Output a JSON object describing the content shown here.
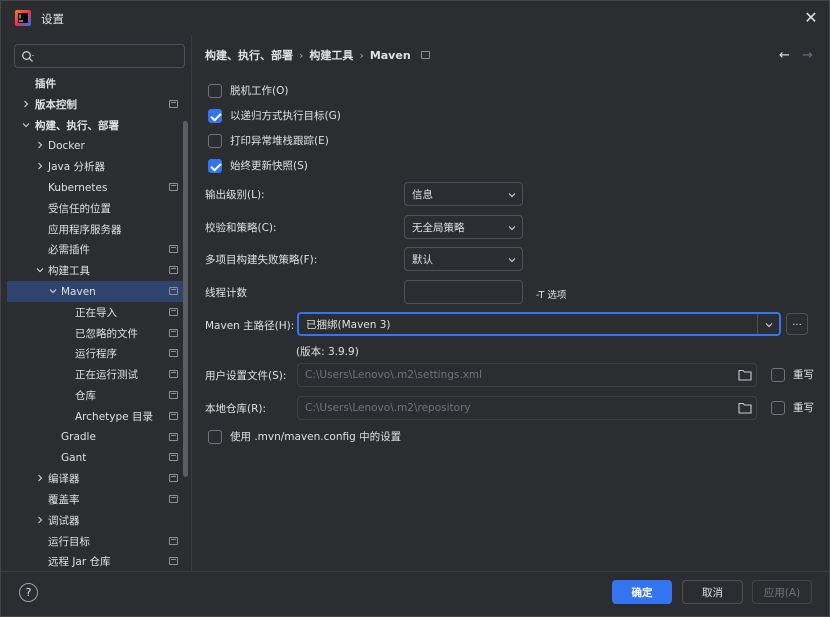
{
  "window": {
    "title": "设置"
  },
  "search": {
    "placeholder": ""
  },
  "tree": [
    {
      "label": "插件",
      "level": 0,
      "chev": "",
      "pg": false,
      "bold": true
    },
    {
      "label": "版本控制",
      "level": 0,
      "chev": "right",
      "pg": true,
      "bold": true
    },
    {
      "label": "构建、执行、部署",
      "level": 0,
      "chev": "down",
      "pg": false,
      "bold": true
    },
    {
      "label": "Docker",
      "level": 1,
      "chev": "right",
      "pg": false
    },
    {
      "label": "Java 分析器",
      "level": 1,
      "chev": "right",
      "pg": false
    },
    {
      "label": "Kubernetes",
      "level": 1,
      "chev": "",
      "pg": true
    },
    {
      "label": "受信任的位置",
      "level": 1,
      "chev": "",
      "pg": false
    },
    {
      "label": "应用程序服务器",
      "level": 1,
      "chev": "",
      "pg": false
    },
    {
      "label": "必需插件",
      "level": 1,
      "chev": "",
      "pg": true
    },
    {
      "label": "构建工具",
      "level": 1,
      "chev": "down",
      "pg": true
    },
    {
      "label": "Maven",
      "level": 2,
      "chev": "down",
      "pg": true,
      "selected": true
    },
    {
      "label": "正在导入",
      "level": 3,
      "chev": "",
      "pg": true
    },
    {
      "label": "已忽略的文件",
      "level": 3,
      "chev": "",
      "pg": true
    },
    {
      "label": "运行程序",
      "level": 3,
      "chev": "",
      "pg": true
    },
    {
      "label": "正在运行测试",
      "level": 3,
      "chev": "",
      "pg": true
    },
    {
      "label": "仓库",
      "level": 3,
      "chev": "",
      "pg": true
    },
    {
      "label": "Archetype 目录",
      "level": 3,
      "chev": "",
      "pg": true
    },
    {
      "label": "Gradle",
      "level": 2,
      "chev": "",
      "pg": true
    },
    {
      "label": "Gant",
      "level": 2,
      "chev": "",
      "pg": true
    },
    {
      "label": "编译器",
      "level": 1,
      "chev": "right",
      "pg": true
    },
    {
      "label": "覆盖率",
      "level": 1,
      "chev": "",
      "pg": true
    },
    {
      "label": "调试器",
      "level": 1,
      "chev": "right",
      "pg": false
    },
    {
      "label": "运行目标",
      "level": 1,
      "chev": "",
      "pg": true
    },
    {
      "label": "远程 Jar 仓库",
      "level": 1,
      "chev": "",
      "pg": true
    }
  ],
  "breadcrumb": {
    "part1": "构建、执行、部署",
    "part2": "构建工具",
    "part3": "Maven"
  },
  "options": {
    "offline": {
      "label": "脱机工作(O)",
      "checked": false
    },
    "recursive": {
      "label": "以递归方式执行目标(G)",
      "checked": true
    },
    "stacktrace": {
      "label": "打印异常堆栈跟踪(E)",
      "checked": false
    },
    "update_snapshots": {
      "label": "始终更新快照(S)",
      "checked": true
    }
  },
  "output_level": {
    "label": "输出级别(L):",
    "value": "信息"
  },
  "checksum_policy": {
    "label": "校验和策略(C):",
    "value": "无全局策略"
  },
  "failure_policy": {
    "label": "多项目构建失败策略(F):",
    "value": "默认"
  },
  "thread_count": {
    "label": "线程计数",
    "value": "",
    "hint": "-T 选项"
  },
  "maven_home": {
    "label": "Maven 主路径(H):",
    "value": "已捆绑(Maven 3)",
    "browse": "...",
    "version": "(版本: 3.9.9)"
  },
  "user_settings": {
    "label": "用户设置文件(S):",
    "value": "C:\\Users\\Lenovo\\.m2\\settings.xml",
    "override": "重写"
  },
  "local_repo": {
    "label": "本地仓库(R):",
    "value": "C:\\Users\\Lenovo\\.m2\\repository",
    "override": "重写"
  },
  "use_mvn_config": {
    "label": "使用 .mvn/maven.config 中的设置",
    "checked": false
  },
  "buttons": {
    "help": "?",
    "ok": "确定",
    "cancel": "取消",
    "apply": "应用(A)"
  },
  "colors": {
    "accent": "#3574f0",
    "background": "#2b2d30",
    "selection": "#2e436e"
  }
}
